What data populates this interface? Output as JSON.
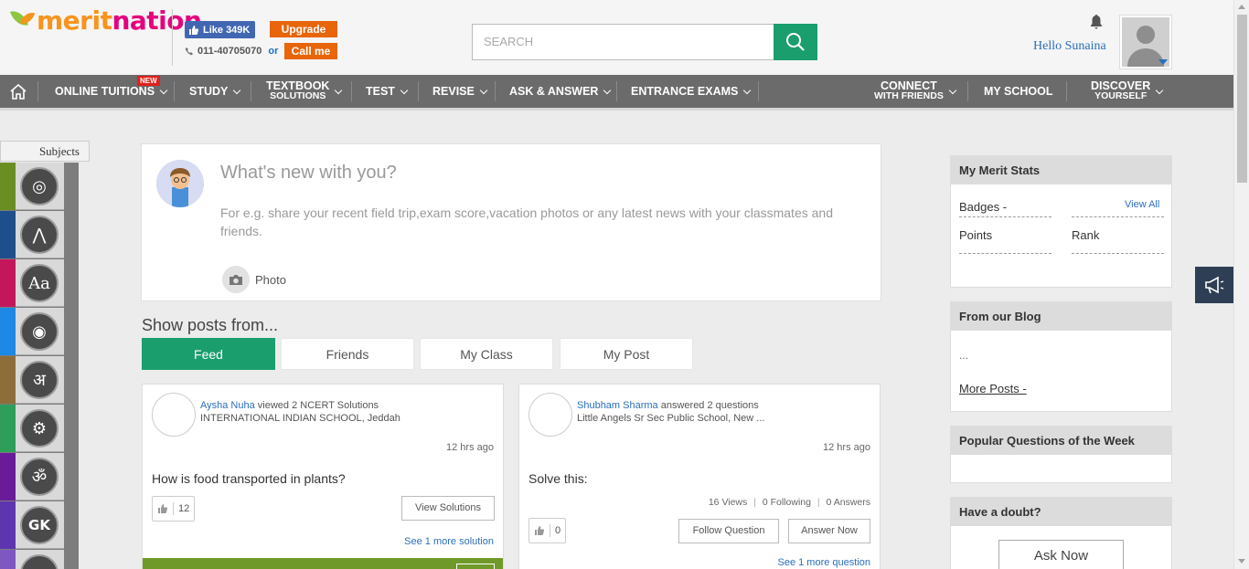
{
  "header": {
    "logo_part1": "merit",
    "logo_part2": "nation",
    "fb_like_label": "Like 349K",
    "upgrade_label": "Upgrade",
    "phone": "011-40705070",
    "or_text": "or",
    "callme_label": "Call me",
    "search_placeholder": "SEARCH",
    "greeting": "Hello Sunaina"
  },
  "nav": {
    "items": [
      {
        "label": "ONLINE TUITIONS",
        "badge": "NEW"
      },
      {
        "label": "STUDY"
      },
      {
        "label1": "TEXTBOOK",
        "label2": "SOLUTIONS"
      },
      {
        "label": "TEST"
      },
      {
        "label": "REVISE"
      },
      {
        "label": "ASK & ANSWER"
      },
      {
        "label": "ENTRANCE EXAMS"
      },
      {
        "label1": "CONNECT",
        "label2": "WITH FRIENDS"
      },
      {
        "label": "MY SCHOOL"
      },
      {
        "label1": "DISCOVER",
        "label2": "YOURSELF"
      }
    ]
  },
  "subjects": {
    "title": "Subjects",
    "items": [
      {
        "icon": "orbit-icon",
        "color": "#6b8e23",
        "glyph": "◎"
      },
      {
        "icon": "compass-icon",
        "color": "#1f4e8c",
        "glyph": "⋀"
      },
      {
        "icon": "font-icon",
        "color": "#c2185b",
        "glyph": "Aa"
      },
      {
        "icon": "globe-icon",
        "color": "#1e88e5",
        "glyph": "◉"
      },
      {
        "icon": "hindi-icon",
        "color": "#8d6e3a",
        "glyph": "अ"
      },
      {
        "icon": "gears-icon",
        "color": "#2e9e5b",
        "glyph": "⚙"
      },
      {
        "icon": "sanskrit-icon",
        "color": "#6a1b9a",
        "glyph": "ॐ"
      },
      {
        "icon": "gk-icon",
        "color": "#5e35b1",
        "glyph": "GK"
      },
      {
        "icon": "more-icon",
        "color": "#7e57c2",
        "glyph": "•••"
      }
    ]
  },
  "composer": {
    "title": "What's new with you?",
    "hint": "For e.g. share your recent field trip,exam score,vacation photos or any latest news with your classmates and friends.",
    "photo_label": "Photo"
  },
  "feed": {
    "heading": "Show posts from...",
    "tabs": [
      "Feed",
      "Friends",
      "My Class",
      "My Post"
    ],
    "posts": [
      {
        "user": "Aysha Nuha",
        "action": " viewed 2 NCERT Solutions",
        "school": "INTERNATIONAL INDIAN SCHOOL, Jeddah",
        "time": "12 hrs ago",
        "question": "How is food transported in plants?",
        "likes": "12",
        "action_button": "View Solutions",
        "see_more": "See 1 more solution"
      },
      {
        "user": "Shubham Sharma",
        "action": " answered 2 questions",
        "school": "Little Angels Sr Sec Public School, New ...",
        "time": "12 hrs ago",
        "question": "Solve this:",
        "views": "16 Views",
        "following": "0 Following",
        "answers": "0 Answers",
        "likes": "0",
        "follow_button": "Follow Question",
        "answer_button": "Answer Now",
        "see_more": "See 1 more question"
      }
    ]
  },
  "sidebar": {
    "stats_title": "My Merit Stats",
    "badges_label": "Badges -",
    "view_all": "View All",
    "points_label": "Points",
    "rank_label": "Rank",
    "blog_title": "From our Blog",
    "blog_ellipsis": "...",
    "more_posts": "More Posts -",
    "popular_title": "Popular Questions of the Week",
    "doubt_title": "Have a doubt?",
    "ask_now": "Ask Now"
  },
  "colors": {
    "accent_green": "#1a9e6e",
    "orange": "#e8650a",
    "nav_bg": "#6b6b6b",
    "link_blue": "#2a6ebb"
  }
}
